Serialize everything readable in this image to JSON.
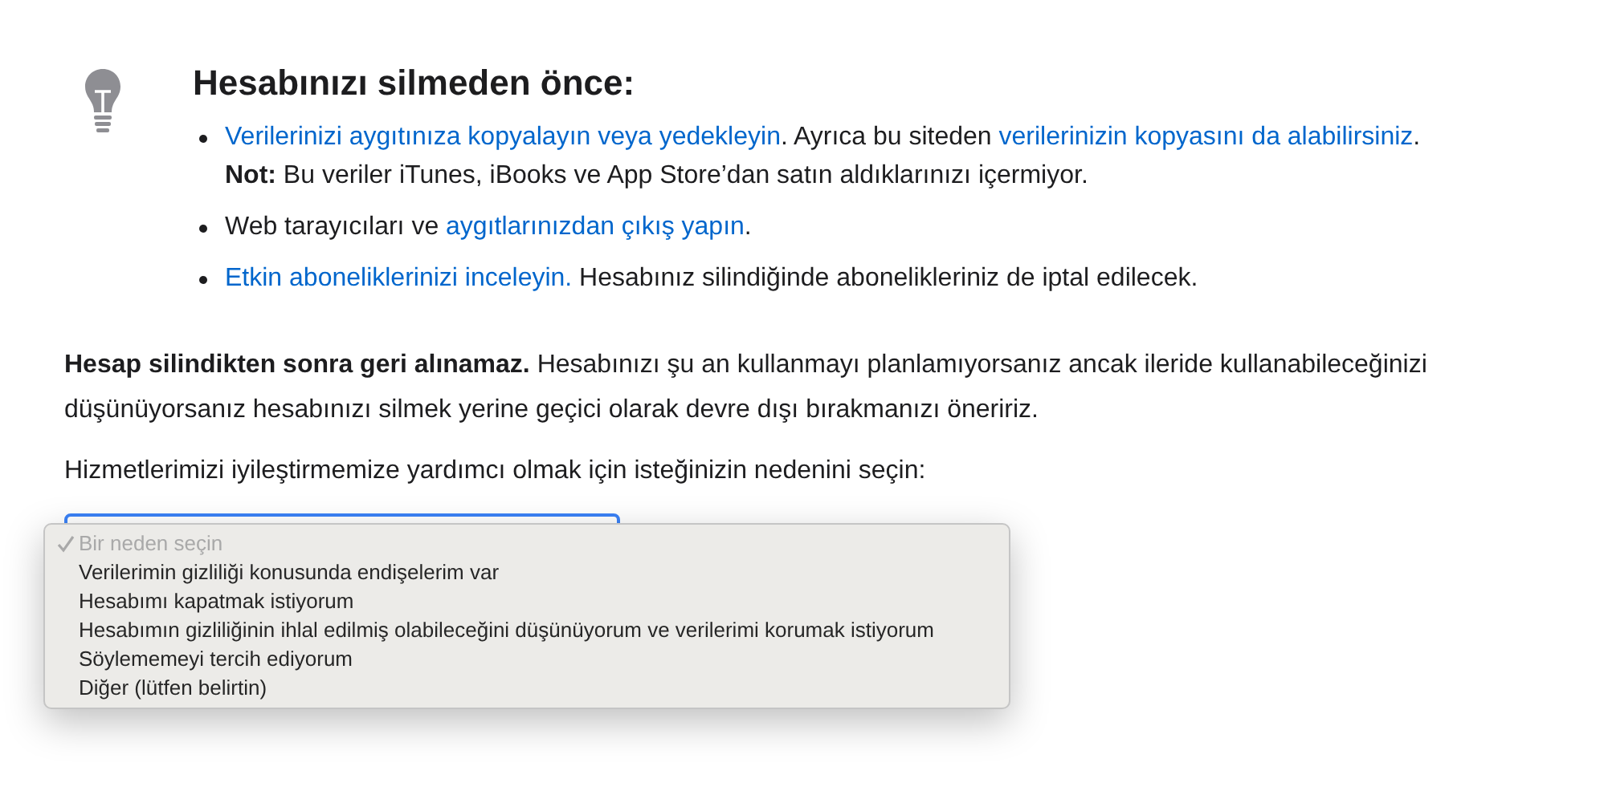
{
  "heading": "Hesabınızı silmeden önce:",
  "bullets": [
    {
      "lines": [
        [
          {
            "kind": "link",
            "text": "Verilerinizi aygıtınıza kopyalayın veya yedekleyin"
          },
          {
            "kind": "text",
            "text": ". Ayrıca bu siteden "
          },
          {
            "kind": "link",
            "text": "verilerinizin kopyasını da alabilirsiniz"
          },
          {
            "kind": "text",
            "text": "."
          }
        ],
        [
          {
            "kind": "bold",
            "text": "Not:"
          },
          {
            "kind": "text",
            "text": " Bu veriler iTunes, iBooks ve App Store’dan satın aldıklarınızı içermiyor."
          }
        ]
      ]
    },
    {
      "lines": [
        [
          {
            "kind": "text",
            "text": "Web tarayıcıları ve "
          },
          {
            "kind": "link",
            "text": "aygıtlarınızdan çıkış yapın"
          },
          {
            "kind": "text",
            "text": "."
          }
        ]
      ]
    },
    {
      "lines": [
        [
          {
            "kind": "link",
            "text": "Etkin aboneliklerinizi inceleyin."
          },
          {
            "kind": "text",
            "text": " Hesabınız silindiğinde abonelikleriniz de iptal edilecek."
          }
        ]
      ]
    }
  ],
  "warning": "**Hesap silindikten sonra geri alınamaz.** Hesabınızı şu an kullanmayı planlamıyorsanız ancak ileride kullanabileceğinizi düşünüyorsanız hesabınızı silmek yerine geçici olarak devre dışı bırakmanızı öneririz.",
  "prompt": "Hizmetlerimizi iyileştirmemize yardımcı olmak için isteğinizin nedenini seçin:",
  "reason_menu": {
    "options": [
      {
        "label": "Bir neden seçin",
        "selected": true,
        "disabled": true
      },
      {
        "label": "Verilerimin gizliliği konusunda endişelerim var",
        "selected": false,
        "disabled": false
      },
      {
        "label": "Hesabımı kapatmak istiyorum",
        "selected": false,
        "disabled": false
      },
      {
        "label": "Hesabımın gizliliğinin ihlal edilmiş olabileceğini düşünüyorum ve verilerimi korumak istiyorum",
        "selected": false,
        "disabled": false
      },
      {
        "label": "Söylememeyi tercih ediyorum",
        "selected": false,
        "disabled": false
      },
      {
        "label": "Diğer (lütfen belirtin)",
        "selected": false,
        "disabled": false
      }
    ]
  }
}
